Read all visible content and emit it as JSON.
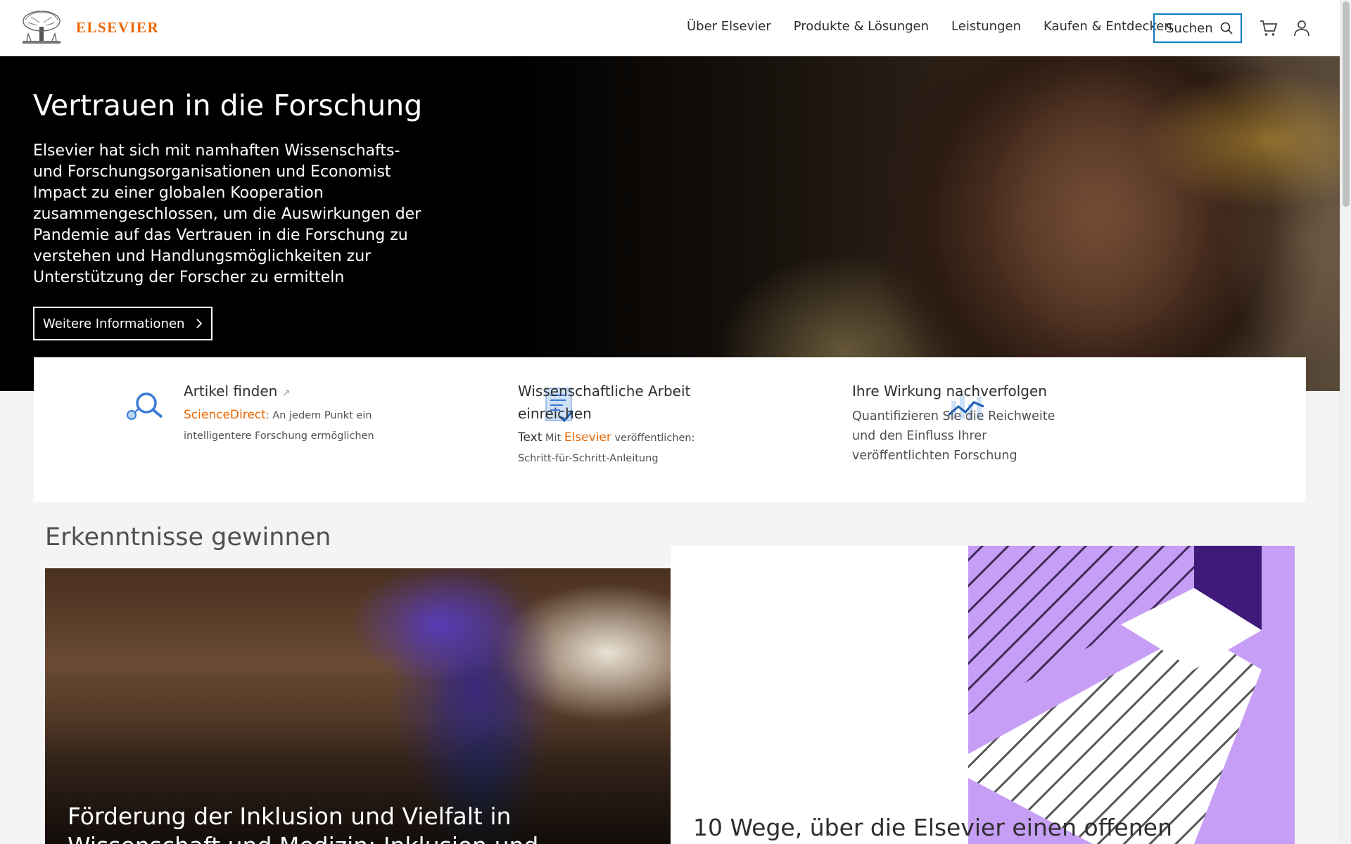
{
  "header": {
    "logo_text": "ELSEVIER",
    "nav": [
      "Über Elsevier",
      "Produkte & Lösungen",
      "Leistungen",
      "Kaufen & Entdecken"
    ],
    "search_label": "Suchen"
  },
  "hero": {
    "title": "Vertrauen in die Forschung",
    "text": "Elsevier hat sich mit namhaften Wissenschafts- und Forschungsorganisationen und Economist Impact zu einer globalen Kooperation zusammengeschlossen, um die Auswirkungen der Pandemie auf das Vertrauen in die Forschung zu verstehen und Handlungsmöglichkeiten zur Unterstützung der Forscher zu ermitteln",
    "button": "Weitere Informationen"
  },
  "features": [
    {
      "title": "Artikel finden",
      "title_suffix": "↗",
      "link": "ScienceDirect",
      "desc": ": An jedem Punkt ein intelligentere Forschung ermöglichen"
    },
    {
      "title": "Wissenschaftliche Arbeit einreichen",
      "prefix": "Text",
      "desc_a": " Mit ",
      "link": "Elsevier",
      "desc_b": " veröffentlichen: Schritt-für-Schritt-Anleitung"
    },
    {
      "title": "Ihre Wirkung nachverfolgen",
      "desc": "Quantifizieren Sie die Reichweite und den Einfluss Ihrer veröffentlichten Forschung"
    }
  ],
  "insights": {
    "title": "Erkenntnisse gewinnen",
    "card_left_title": "Förderung der Inklusion und Vielfalt in Wissenschaft und Medizin: Inklusion und",
    "card_right_title": "10 Wege, über die Elsevier einen offenen"
  },
  "colors": {
    "brand_orange": "#eb6500",
    "accent_blue": "#0c7dbb",
    "purple_light": "#c79ef5",
    "purple_dark": "#3f1a7a"
  },
  "icons": [
    "search-icon",
    "cart-icon",
    "user-icon",
    "chevron-right-icon",
    "external-link-icon",
    "magnifier-feature-icon",
    "document-check-icon",
    "chart-trend-icon"
  ]
}
